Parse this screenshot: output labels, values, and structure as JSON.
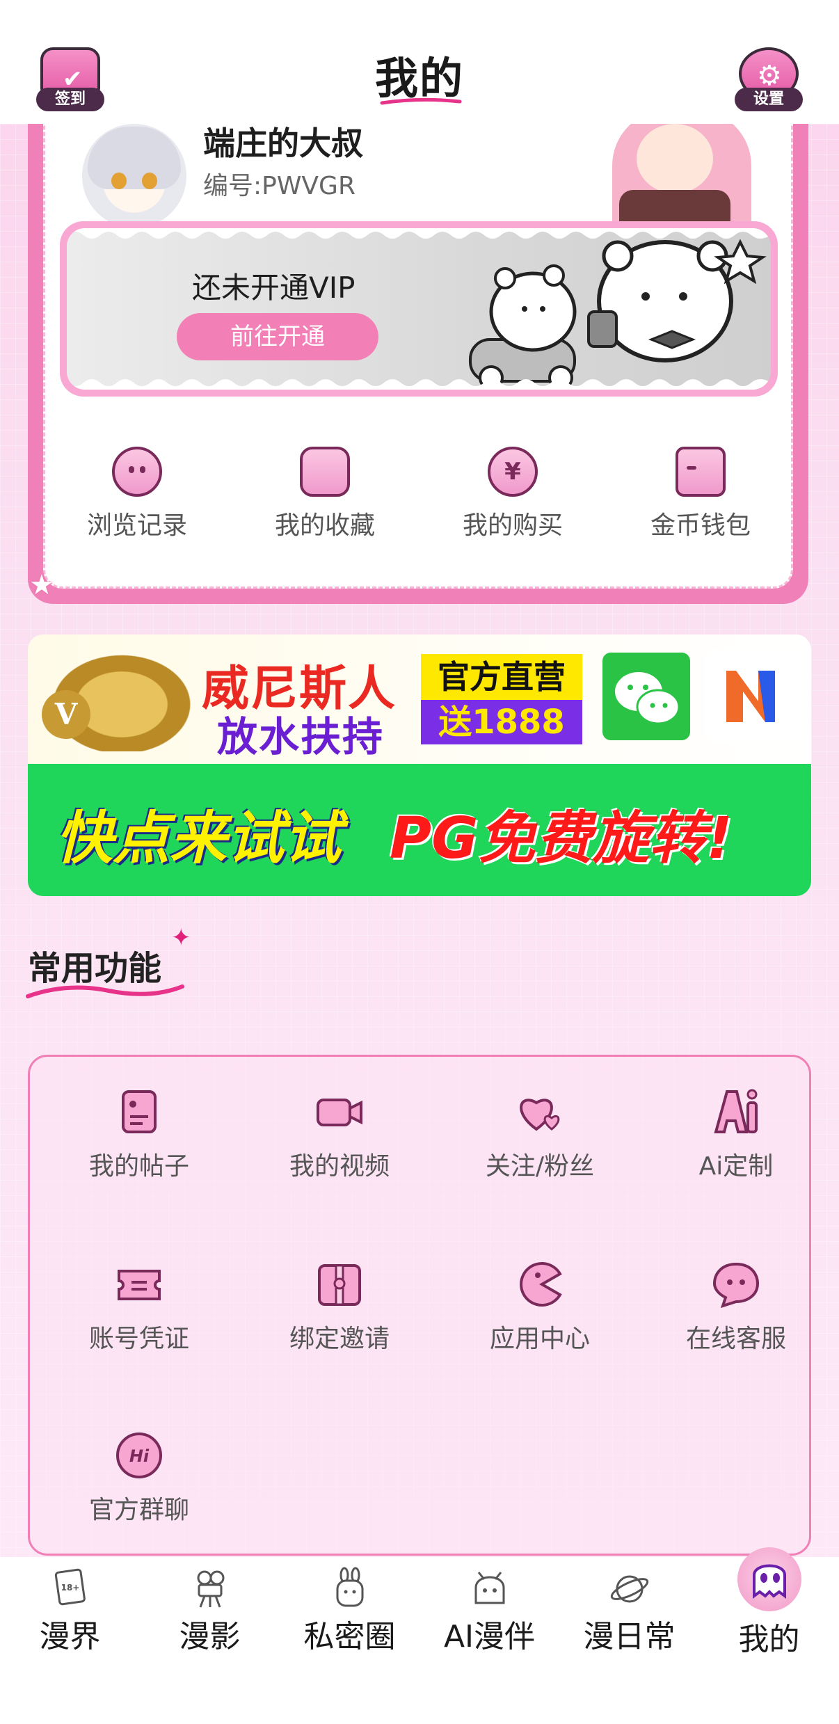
{
  "header": {
    "title": "我的",
    "checkin_label": "签到",
    "settings_label": "设置"
  },
  "profile": {
    "name": "端庄的大叔",
    "id_text": "编号:PWVGR"
  },
  "vip": {
    "status": "还未开通VIP",
    "button": "前往开通"
  },
  "quick_actions": [
    {
      "label": "浏览记录",
      "icon": "history-icon"
    },
    {
      "label": "我的收藏",
      "icon": "star-icon"
    },
    {
      "label": "我的购买",
      "icon": "yen-icon"
    },
    {
      "label": "金币钱包",
      "icon": "wallet-icon"
    }
  ],
  "ad": {
    "top_line1": "威尼斯人",
    "top_line2": "放水扶持",
    "badge_line1": "官方直营",
    "badge_line2": "送1888",
    "bottom_left": "快点来试试",
    "bottom_right": "PG免费旋转!"
  },
  "section": {
    "title": "常用功能"
  },
  "functions": [
    {
      "label": "我的帖子",
      "icon": "post-icon"
    },
    {
      "label": "我的视频",
      "icon": "video-camera-icon"
    },
    {
      "label": "关注/粉丝",
      "icon": "hearts-icon"
    },
    {
      "label": "Ai定制",
      "icon": "ai-icon"
    },
    {
      "label": "账号凭证",
      "icon": "ticket-icon"
    },
    {
      "label": "绑定邀请",
      "icon": "invite-icon"
    },
    {
      "label": "应用中心",
      "icon": "pacman-icon"
    },
    {
      "label": "在线客服",
      "icon": "chat-bubble-icon"
    },
    {
      "label": "官方群聊",
      "icon": "hi-icon"
    }
  ],
  "bottom_nav": [
    {
      "label": "漫界",
      "icon": "book-18-icon"
    },
    {
      "label": "漫影",
      "icon": "film-camera-icon"
    },
    {
      "label": "私密圈",
      "icon": "bunny-icon"
    },
    {
      "label": "AI漫伴",
      "icon": "anime-girl-icon"
    },
    {
      "label": "漫日常",
      "icon": "planet-icon"
    },
    {
      "label": "我的",
      "icon": "ghost-icon",
      "active": true
    }
  ],
  "colors": {
    "accent": "#f080b8",
    "background": "#fbe0f2",
    "ad_green": "#1fd65a"
  }
}
